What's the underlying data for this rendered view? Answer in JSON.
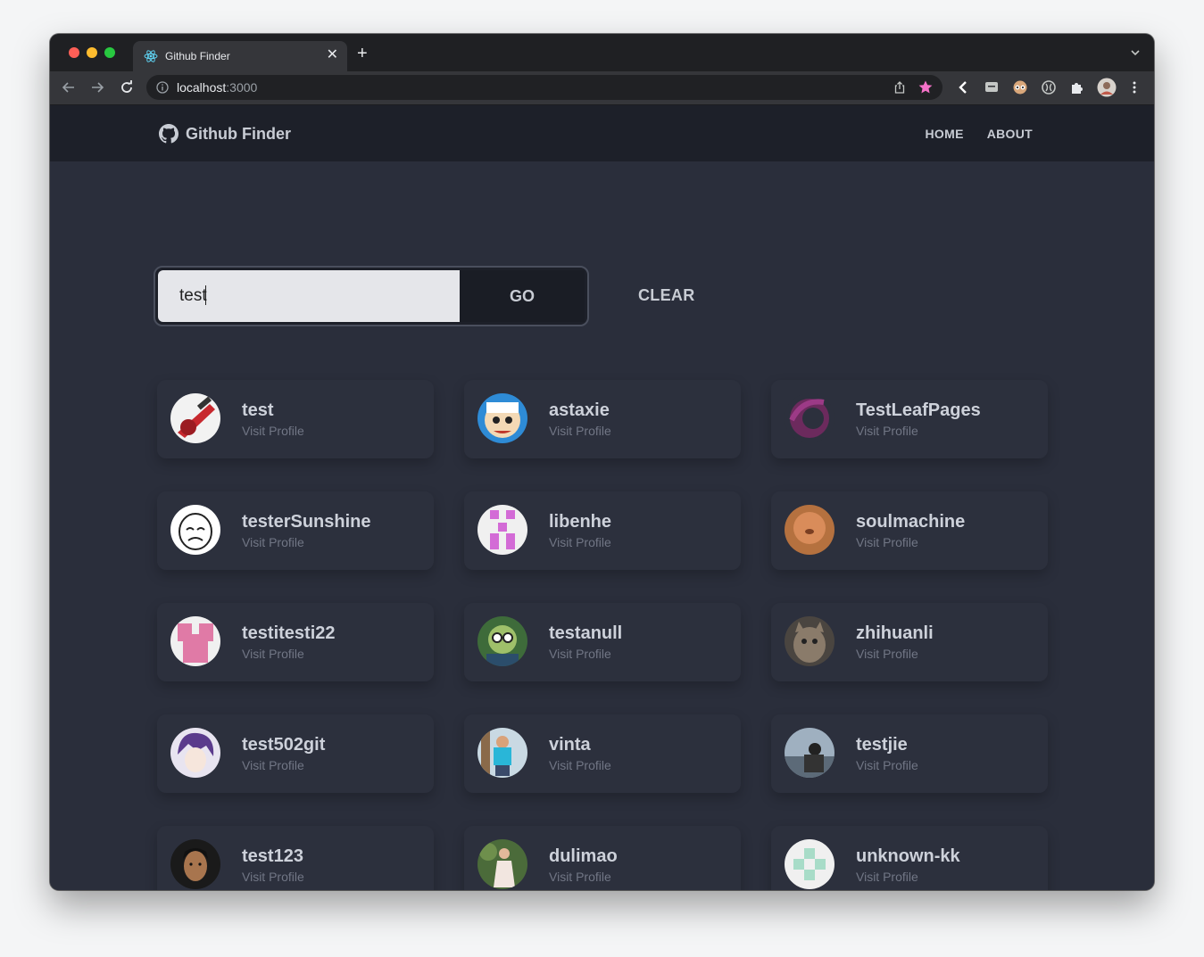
{
  "browser": {
    "tab_title": "Github Finder",
    "url_host": "localhost",
    "url_port": ":3000"
  },
  "navbar": {
    "brand": "Github Finder",
    "links": [
      "HOME",
      "ABOUT"
    ]
  },
  "search": {
    "value": "test",
    "go_label": "GO",
    "clear_label": "CLEAR"
  },
  "users": [
    {
      "login": "test",
      "link": "Visit Profile"
    },
    {
      "login": "astaxie",
      "link": "Visit Profile"
    },
    {
      "login": "TestLeafPages",
      "link": "Visit Profile"
    },
    {
      "login": "testerSunshine",
      "link": "Visit Profile"
    },
    {
      "login": "libenhe",
      "link": "Visit Profile"
    },
    {
      "login": "soulmachine",
      "link": "Visit Profile"
    },
    {
      "login": "testitesti22",
      "link": "Visit Profile"
    },
    {
      "login": "testanull",
      "link": "Visit Profile"
    },
    {
      "login": "zhihuanli",
      "link": "Visit Profile"
    },
    {
      "login": "test502git",
      "link": "Visit Profile"
    },
    {
      "login": "vinta",
      "link": "Visit Profile"
    },
    {
      "login": "testjie",
      "link": "Visit Profile"
    },
    {
      "login": "test123",
      "link": "Visit Profile"
    },
    {
      "login": "dulimao",
      "link": "Visit Profile"
    },
    {
      "login": "unknown-kk",
      "link": "Visit Profile"
    }
  ],
  "colors": {
    "page_bg": "#2a2e3b",
    "navbar_bg": "#1d2029",
    "card_bg": "#2c303d",
    "favorite_star": "#f472c8"
  }
}
